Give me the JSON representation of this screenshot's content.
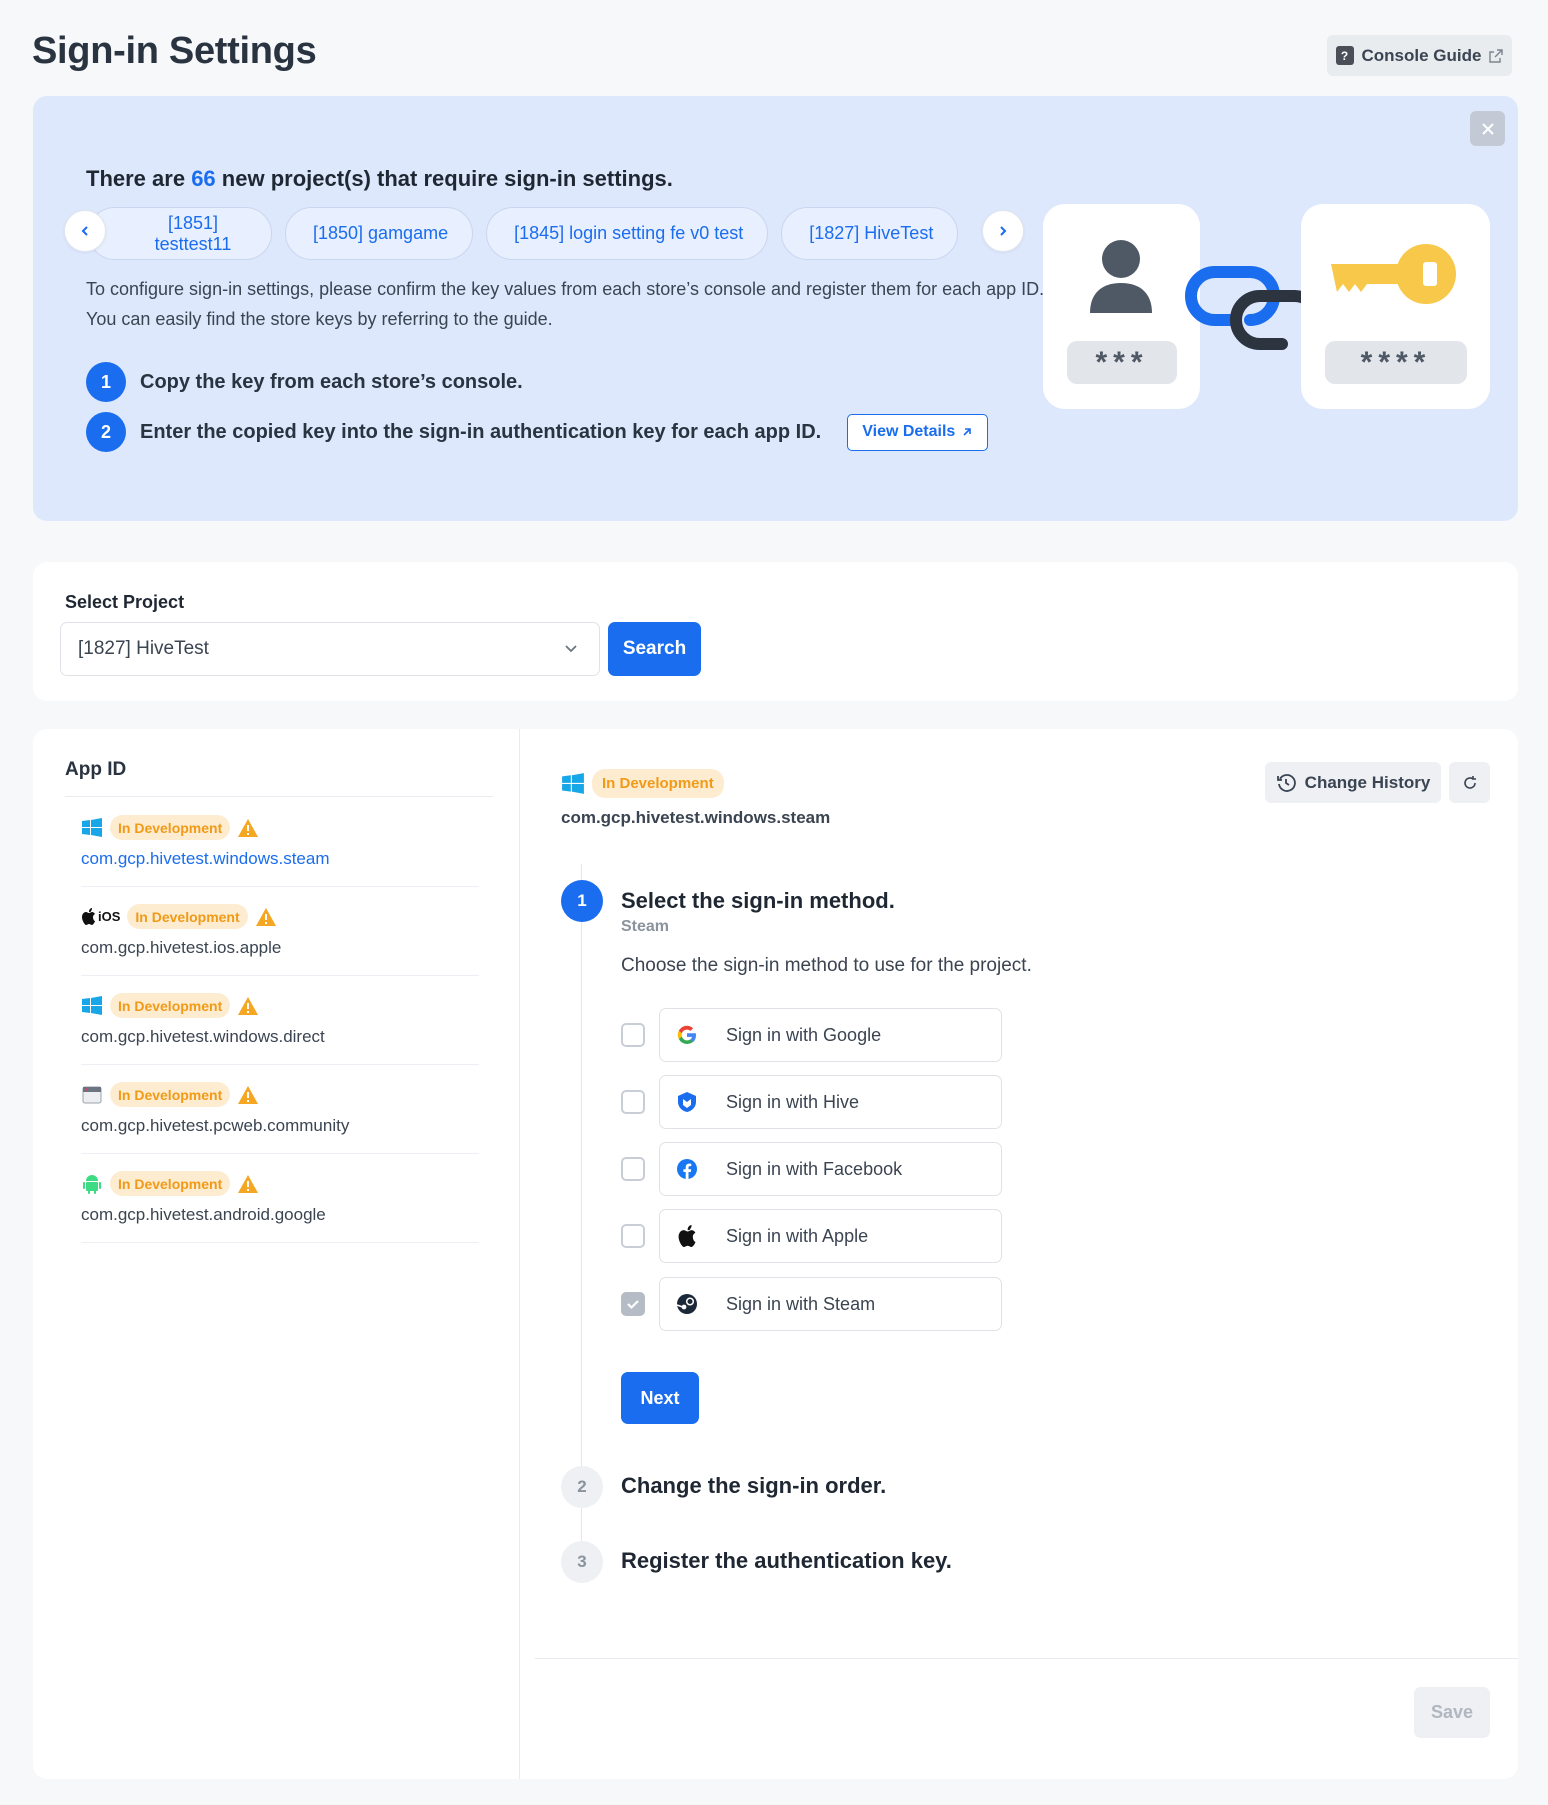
{
  "header": {
    "title": "Sign-in Settings",
    "console_guide": "Console Guide"
  },
  "banner": {
    "headline_prefix": "There are",
    "count": "66",
    "headline_suffix": "new project(s) that require sign-in settings.",
    "chips": [
      "[1851] testtest11",
      "[1850] gamgame",
      "[1845] login setting fe v0 test",
      "[1827] HiveTest"
    ],
    "description": "To configure sign-in settings, please confirm the key values from each store’s console and register them for each app ID. You can easily find the store keys by referring to the guide.",
    "steps": [
      {
        "num": "1",
        "text": "Copy the key from each store’s console."
      },
      {
        "num": "2",
        "text": "Enter the copied key into the sign-in authentication key for each app ID."
      }
    ],
    "view_details": "View Details",
    "illustration": {
      "password_left": "***",
      "password_right": "****"
    }
  },
  "project": {
    "label": "Select Project",
    "selected": "[1827] HiveTest",
    "search": "Search"
  },
  "app_list": {
    "title": "App ID",
    "items": [
      {
        "platform": "windows-icon",
        "badge": "In Development",
        "package": "com.gcp.hivetest.windows.steam"
      },
      {
        "platform": "apple-ios-icon",
        "platform_text": "iOS",
        "badge": "In Development",
        "package": "com.gcp.hivetest.ios.apple"
      },
      {
        "platform": "windows-icon",
        "badge": "In Development",
        "package": "com.gcp.hivetest.windows.direct"
      },
      {
        "platform": "browser-icon",
        "badge": "In Development",
        "package": "com.gcp.hivetest.pcweb.community"
      },
      {
        "platform": "android-icon",
        "badge": "In Development",
        "package": "com.gcp.hivetest.android.google"
      }
    ]
  },
  "detail": {
    "badge": "In Development",
    "package": "com.gcp.hivetest.windows.steam",
    "change_history": "Change History",
    "steps": [
      {
        "num": "1",
        "title": "Select the sign-in method.",
        "subtitle": "Steam",
        "description": "Choose the sign-in method to use for the project."
      },
      {
        "num": "2",
        "title": "Change the sign-in order."
      },
      {
        "num": "3",
        "title": "Register the authentication key."
      }
    ],
    "methods": [
      {
        "label": "Sign in with Google",
        "icon": "google-icon",
        "checked": false
      },
      {
        "label": "Sign in with Hive",
        "icon": "hive-icon",
        "checked": false
      },
      {
        "label": "Sign in with Facebook",
        "icon": "facebook-icon",
        "checked": false
      },
      {
        "label": "Sign in with Apple",
        "icon": "apple-icon",
        "checked": false
      },
      {
        "label": "Sign in with Steam",
        "icon": "steam-icon",
        "checked": true
      }
    ],
    "next": "Next",
    "save": "Save"
  },
  "colors": {
    "accent": "#1a6dee",
    "banner_bg": "#dde8fd",
    "badge_bg": "#fdecd0",
    "badge_text": "#f19a18",
    "key_yellow": "#f8c84a"
  }
}
